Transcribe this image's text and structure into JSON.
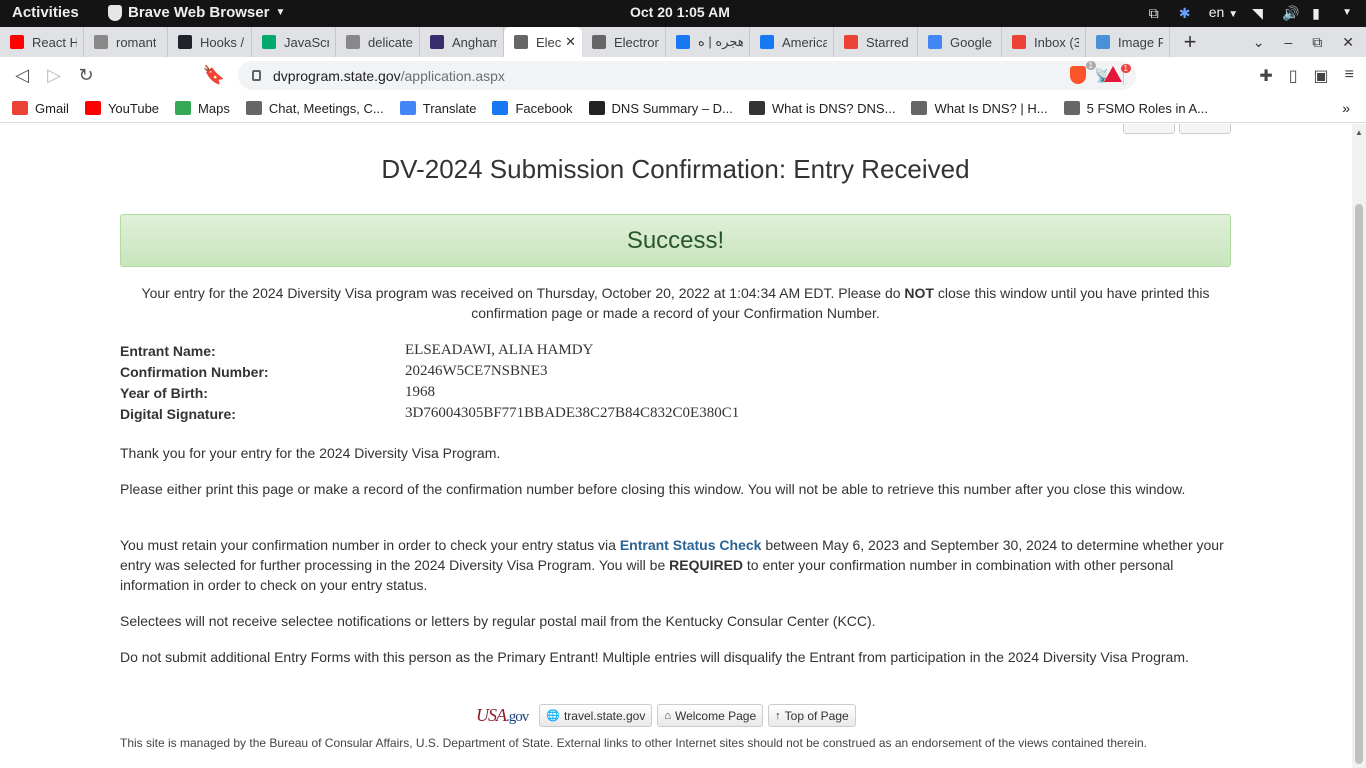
{
  "system_bar": {
    "activities": "Activities",
    "app_name": "Brave Web Browser",
    "clock": "Oct 20   1:05 AM",
    "language": "en"
  },
  "tabs": [
    {
      "title": "React H",
      "favicon": "youtube",
      "color": "#ff0000"
    },
    {
      "title": "romant",
      "favicon": "page",
      "color": "#888888"
    },
    {
      "title": "Hooks /",
      "favicon": "react",
      "color": "#20232a"
    },
    {
      "title": "JavaScr",
      "favicon": "w3",
      "color": "#04aa6d"
    },
    {
      "title": "delicate",
      "favicon": "page",
      "color": "#888888"
    },
    {
      "title": "Angham",
      "favicon": "anghami",
      "color": "#3a2d6b"
    },
    {
      "title": "Elect",
      "favicon": "globe",
      "color": "#666666",
      "active": true
    },
    {
      "title": "Electron",
      "favicon": "globe",
      "color": "#666666"
    },
    {
      "title": "هجره | ه",
      "favicon": "facebook",
      "color": "#1877f2"
    },
    {
      "title": "America",
      "favicon": "facebook",
      "color": "#1877f2"
    },
    {
      "title": "Starred",
      "favicon": "gmail",
      "color": "#ea4335"
    },
    {
      "title": "Google",
      "favicon": "google-translate",
      "color": "#4285f4"
    },
    {
      "title": "Inbox (3",
      "favicon": "gmail",
      "color": "#ea4335"
    },
    {
      "title": "Image R",
      "favicon": "image",
      "color": "#4a90d9"
    }
  ],
  "toolbar": {
    "url_host": "dvprogram.state.gov",
    "url_path": "/application.aspx",
    "shield_badge": "1",
    "rewards_badge": "1"
  },
  "bookmarks": [
    {
      "label": "Gmail",
      "icon": "gmail-icon",
      "color": "#ea4335"
    },
    {
      "label": "YouTube",
      "icon": "youtube-icon",
      "color": "#ff0000"
    },
    {
      "label": "Maps",
      "icon": "maps-icon",
      "color": "#34a853"
    },
    {
      "label": "Chat, Meetings, C...",
      "icon": "globe-icon",
      "color": "#666666"
    },
    {
      "label": "Translate",
      "icon": "translate-icon",
      "color": "#4285f4"
    },
    {
      "label": "Facebook",
      "icon": "facebook-icon",
      "color": "#1877f2"
    },
    {
      "label": "DNS Summary – D...",
      "icon": "dns-icon",
      "color": "#222222"
    },
    {
      "label": "What is DNS? DNS...",
      "icon": "nsl-icon",
      "color": "#333333"
    },
    {
      "label": "What Is DNS? | H...",
      "icon": "globe-icon",
      "color": "#666666"
    },
    {
      "label": "5 FSMO Roles in A...",
      "icon": "globe-icon",
      "color": "#666666"
    }
  ],
  "page": {
    "title": "DV-2024 Submission Confirmation: Entry Received",
    "success": "Success!",
    "received_pre": "Your entry for the 2024 Diversity Visa program was received on Thursday, October 20, 2022 at 1:04:34 AM EDT. Please do ",
    "received_not": "NOT",
    "received_post": " close this window until you have printed this confirmation page or made a record of your Confirmation Number.",
    "details": [
      {
        "label": "Entrant Name:",
        "value": "ELSEADAWI, ALIA HAMDY"
      },
      {
        "label": "Confirmation Number:",
        "value": "20246W5CE7NSBNE3"
      },
      {
        "label": "Year of Birth:",
        "value": "1968"
      },
      {
        "label": "Digital Signature:",
        "value": "3D76004305BF771BBADE38C27B84C832C0E380C1"
      }
    ],
    "thanks": "Thank you for your entry for the 2024 Diversity Visa Program.",
    "print_warning": "Please either print this page or make a record of the confirmation number before closing this window. You will not be able to retrieve this number after you close this window.",
    "retain_pre": "You must retain your confirmation number in order to check your entry status via ",
    "retain_link": "Entrant Status Check",
    "retain_mid": " between May 6, 2023 and September 30, 2024 to determine whether your entry was selected for further processing in the 2024 Diversity Visa Program. You will be ",
    "retain_required": "REQUIRED",
    "retain_post": " to enter your confirmation number in combination with other personal information in order to check on your entry status.",
    "selectees": "Selectees will not receive selectee notifications or letters by regular postal mail from the Kentucky Consular Center (KCC).",
    "no_additional": "Do not submit additional Entry Forms with this person as the Primary Entrant! Multiple entries will disqualify the Entrant from participation in the 2024 Diversity Visa Program.",
    "logo_usa": "USA",
    "logo_gov": ".gov",
    "btn_travel": "travel.state.gov",
    "btn_welcome": "Welcome Page",
    "btn_top": "Top of Page",
    "disclaimer": "This site is managed by the Bureau of Consular Affairs, U.S. Department of State. External links to other Internet sites should not be construed as an endorsement of the views contained therein."
  }
}
